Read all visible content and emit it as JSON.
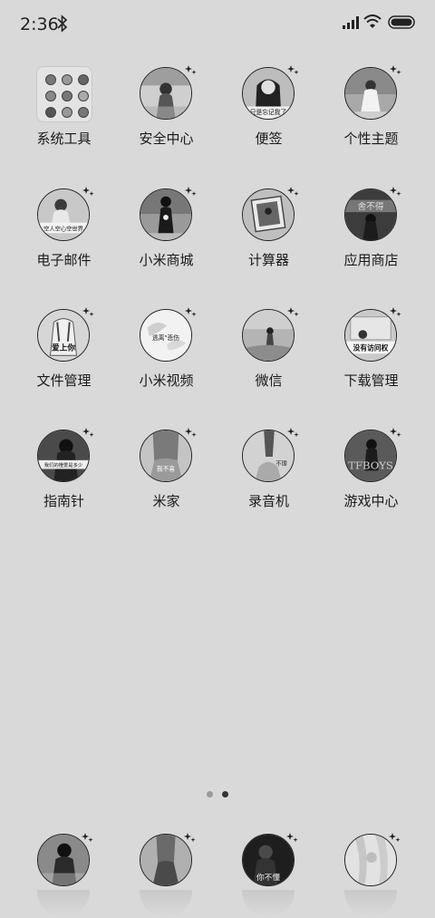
{
  "status_bar": {
    "time": "2:36",
    "icons": [
      "bluetooth-icon",
      "signal-icon",
      "wifi-icon",
      "battery-icon"
    ]
  },
  "apps": [
    {
      "label": "系统工具",
      "kind": "folder"
    },
    {
      "label": "安全中心",
      "kind": "photo"
    },
    {
      "label": "便签",
      "kind": "photo",
      "photo_text": "只是忘记我了"
    },
    {
      "label": "个性主题",
      "kind": "photo"
    },
    {
      "label": "电子邮件",
      "kind": "photo",
      "photo_text": "空人空心空世界"
    },
    {
      "label": "小米商城",
      "kind": "photo"
    },
    {
      "label": "计算器",
      "kind": "photo"
    },
    {
      "label": "应用商店",
      "kind": "photo",
      "photo_text": "舍不得"
    },
    {
      "label": "文件管理",
      "kind": "photo",
      "photo_text": "爱上你"
    },
    {
      "label": "小米视频",
      "kind": "photo",
      "photo_text": "逃离\"悲伤"
    },
    {
      "label": "微信",
      "kind": "photo"
    },
    {
      "label": "下载管理",
      "kind": "photo",
      "photo_text": "没有访问权"
    },
    {
      "label": "指南针",
      "kind": "photo",
      "photo_text": "我们的橙爱是多少"
    },
    {
      "label": "米家",
      "kind": "photo",
      "photo_text": "我不喜"
    },
    {
      "label": "录音机",
      "kind": "photo",
      "photo_text": "不理"
    },
    {
      "label": "游戏中心",
      "kind": "photo",
      "photo_text": "TFBOYS"
    }
  ],
  "page_indicator": {
    "pages": 2,
    "current": 2
  },
  "dock": [
    {
      "name": "dock-app-1"
    },
    {
      "name": "dock-app-2"
    },
    {
      "name": "dock-app-3",
      "photo_text": "你不懂"
    },
    {
      "name": "dock-app-4"
    }
  ],
  "colors": {
    "background": "#d9d9d9",
    "outline": "#222222"
  }
}
